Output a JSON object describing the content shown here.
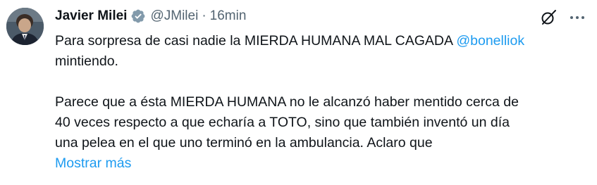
{
  "author": {
    "name": "Javier Milei",
    "handle": "@JMilei",
    "separator": "·",
    "time": "16min"
  },
  "tweet": {
    "line1_text": "Para sorpresa de casi nadie la MIERDA HUMANA MAL CAGADA ",
    "mention": "@bonelliok",
    "line2_text": "mintiendo.",
    "paragraph2": [
      "Parece que a ésta MIERDA HUMANA no le alcanzó haber mentido cerca de",
      "40 veces respecto a que echaría a TOTO, sino que también inventó un día",
      "una pelea en el que uno terminó en la ambulancia. Aclaro que"
    ],
    "show_more": "Mostrar más"
  },
  "icons": {
    "verified": "verified-badge-icon",
    "grok": "grok-icon",
    "more": "more-options-icon"
  },
  "colors": {
    "accent": "#1d9bf0",
    "text": "#0f1419",
    "secondary": "#536471"
  }
}
